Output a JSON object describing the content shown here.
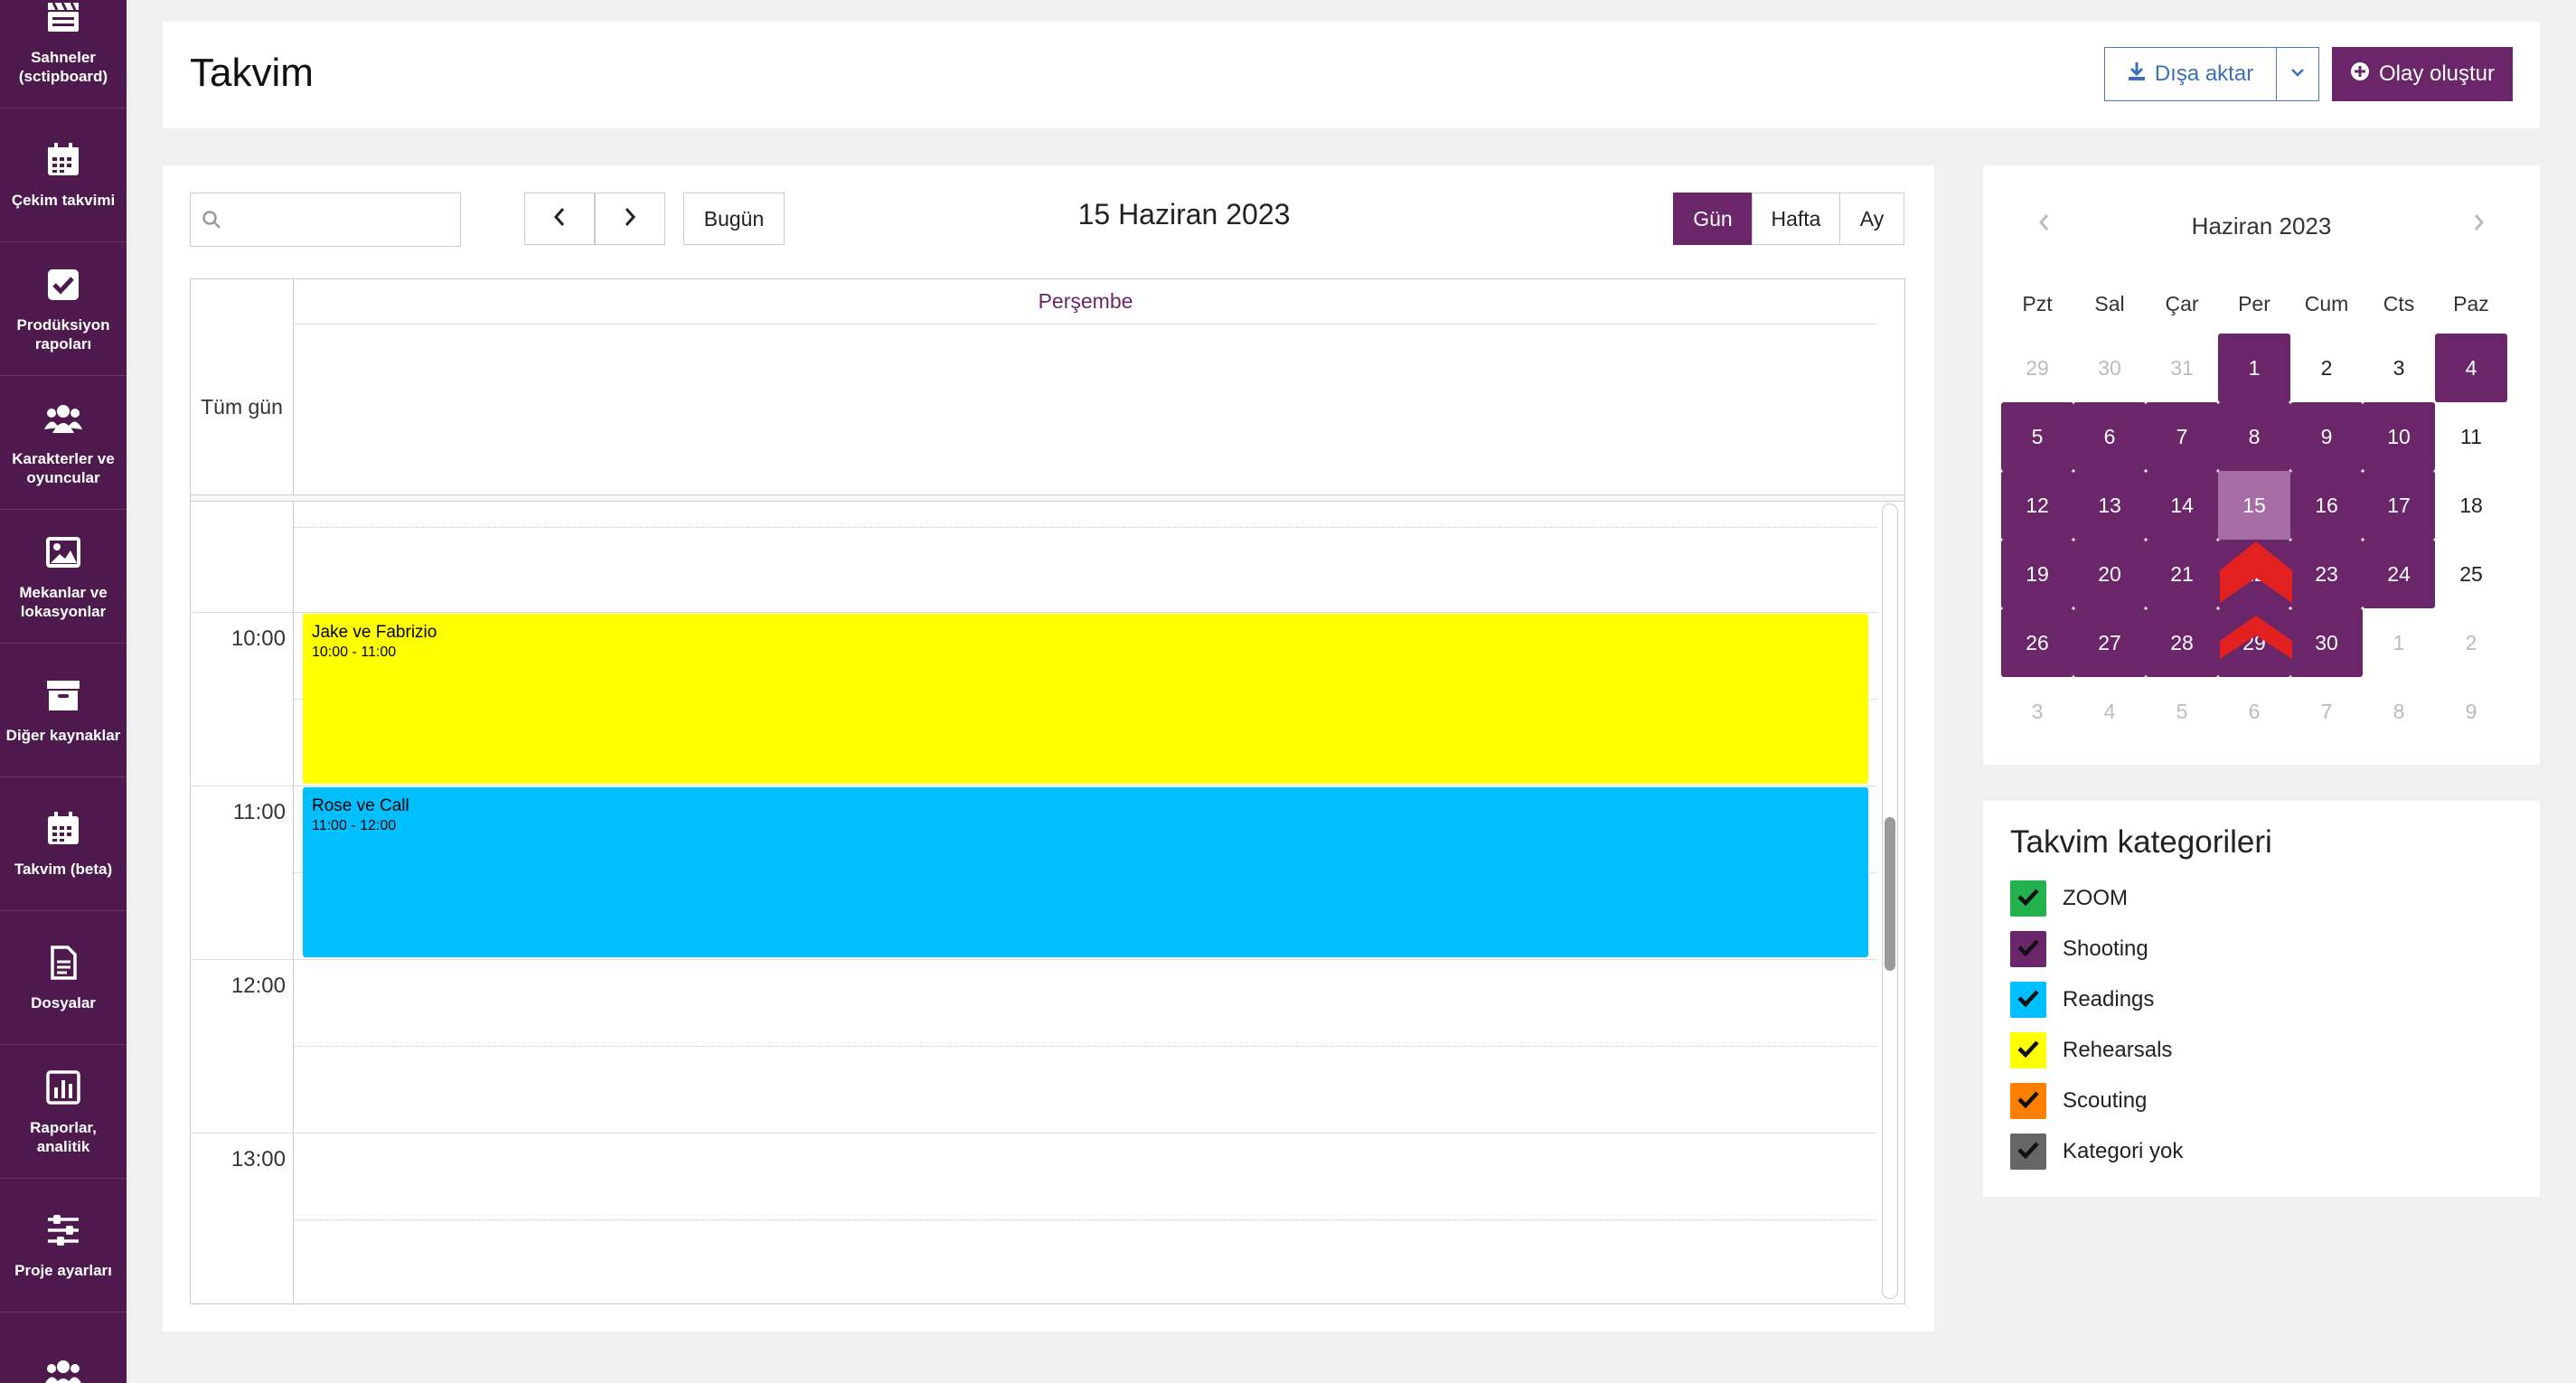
{
  "sidebar": {
    "items": [
      {
        "label": "Sahneler (sctipboard)",
        "icon": "clapperboard-icon"
      },
      {
        "label": "Çekim takvimi",
        "icon": "calendar-icon"
      },
      {
        "label": "Prodüksiyon rapoları",
        "icon": "check-square-icon"
      },
      {
        "label": "Karakterler ve oyuncular",
        "icon": "users-icon"
      },
      {
        "label": "Mekanlar ve lokasyonlar",
        "icon": "image-icon"
      },
      {
        "label": "Diğer kaynaklar",
        "icon": "archive-icon"
      },
      {
        "label": "Takvim (beta)",
        "icon": "calendar-icon"
      },
      {
        "label": "Dosyalar",
        "icon": "document-icon"
      },
      {
        "label": "Raporlar, analitik",
        "icon": "bar-chart-icon"
      },
      {
        "label": "Proje ayarları",
        "icon": "sliders-icon"
      },
      {
        "label": "",
        "icon": "users-icon"
      }
    ]
  },
  "header": {
    "title": "Takvim",
    "export_label": "Dışa aktar",
    "create_label": "Olay oluştur"
  },
  "toolbar": {
    "search_placeholder": "",
    "today_label": "Bugün",
    "current_date": "15 Haziran 2023",
    "views": [
      "Gün",
      "Hafta",
      "Ay"
    ],
    "active_view": "Gün"
  },
  "day_view": {
    "day_name": "Perşembe",
    "allday_label": "Tüm gün",
    "time_labels": [
      "10:00",
      "11:00",
      "12:00",
      "13:00"
    ],
    "events": [
      {
        "title": "Jake ve Fabrizio",
        "time": "10:00 - 11:00",
        "color": "#ffff00"
      },
      {
        "title": "Rose ve Call",
        "time": "11:00 - 12:00",
        "color": "#00bfff"
      }
    ]
  },
  "mini_calendar": {
    "title": "Haziran 2023",
    "weekdays": [
      "Pzt",
      "Sal",
      "Çar",
      "Per",
      "Cum",
      "Cts",
      "Paz"
    ],
    "weeks": [
      [
        "29",
        "30",
        "31",
        "1",
        "2",
        "3",
        "4"
      ],
      [
        "5",
        "6",
        "7",
        "8",
        "9",
        "10",
        "11"
      ],
      [
        "12",
        "13",
        "14",
        "15",
        "16",
        "17",
        "18"
      ],
      [
        "19",
        "20",
        "21",
        "22",
        "23",
        "24",
        "25"
      ],
      [
        "26",
        "27",
        "28",
        "29",
        "30",
        "1",
        "2"
      ],
      [
        "3",
        "4",
        "5",
        "6",
        "7",
        "8",
        "9"
      ]
    ],
    "event_color": "#6b2569"
  },
  "categories": {
    "title": "Takvim kategorileri",
    "items": [
      {
        "label": "ZOOM",
        "color": "#22b14c"
      },
      {
        "label": "Shooting",
        "color": "#6b2569"
      },
      {
        "label": "Readings",
        "color": "#00bfff"
      },
      {
        "label": "Rehearsals",
        "color": "#ffff00"
      },
      {
        "label": "Scouting",
        "color": "#ff7f00"
      },
      {
        "label": "Kategori yok",
        "color": "#666666"
      }
    ]
  }
}
